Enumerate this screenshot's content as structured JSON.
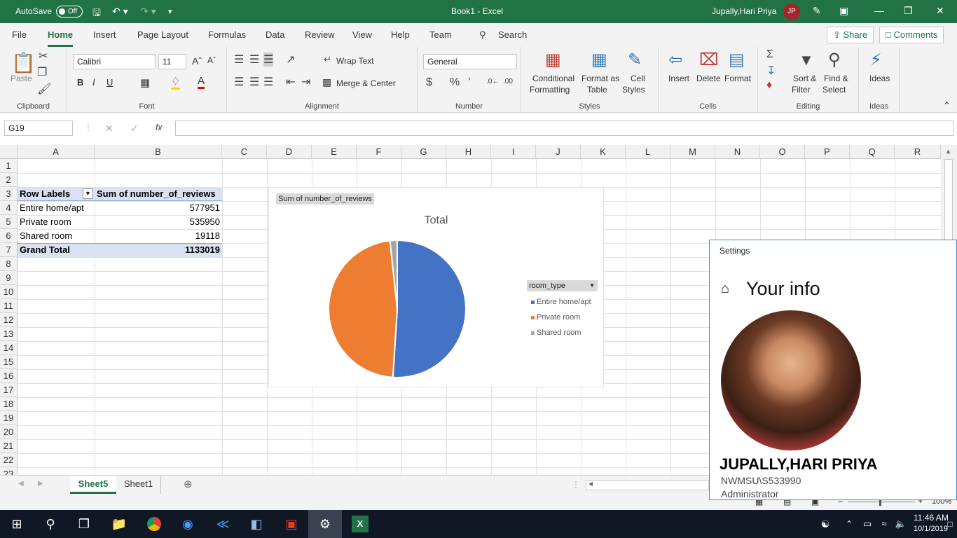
{
  "titlebar": {
    "autosave_label": "AutoSave",
    "autosave_state": "Off",
    "document_title": "Book1  -  Excel",
    "user_name": "Jupally,Hari Priya",
    "user_initials": "JP"
  },
  "menu": {
    "tabs": [
      "File",
      "Home",
      "Insert",
      "Page Layout",
      "Formulas",
      "Data",
      "Review",
      "View",
      "Help",
      "Team"
    ],
    "active_tab": "Home",
    "search_label": "Search",
    "share_label": "Share",
    "comments_label": "Comments"
  },
  "ribbon": {
    "clipboard": {
      "group": "Clipboard",
      "paste": "Paste"
    },
    "font": {
      "group": "Font",
      "font_name": "Calibri",
      "font_size": "11"
    },
    "alignment": {
      "group": "Alignment",
      "wrap_text": "Wrap Text",
      "merge_center": "Merge & Center"
    },
    "number": {
      "group": "Number",
      "format": "General"
    },
    "styles": {
      "group": "Styles",
      "conditional_1": "Conditional",
      "conditional_2": "Formatting",
      "format_as_1": "Format as",
      "format_as_2": "Table",
      "cell_styles_1": "Cell",
      "cell_styles_2": "Styles"
    },
    "cells": {
      "group": "Cells",
      "insert": "Insert",
      "delete": "Delete",
      "format": "Format"
    },
    "editing": {
      "group": "Editing",
      "sort_1": "Sort &",
      "sort_2": "Filter",
      "find_1": "Find &",
      "find_2": "Select"
    },
    "ideas": {
      "group": "Ideas",
      "ideas": "Ideas"
    }
  },
  "formula_bar": {
    "name_box": "G19",
    "fx": "fx",
    "formula": ""
  },
  "sheet": {
    "columns": [
      "A",
      "B",
      "C",
      "D",
      "E",
      "F",
      "G",
      "H",
      "I",
      "J",
      "K",
      "L",
      "M",
      "N",
      "O",
      "P",
      "Q",
      "R"
    ],
    "rows": [
      "1",
      "2",
      "3",
      "4",
      "5",
      "6",
      "7",
      "8",
      "9",
      "10",
      "11",
      "12",
      "13",
      "14",
      "15",
      "16",
      "17",
      "18",
      "19",
      "20",
      "21",
      "22",
      "23"
    ],
    "pivot": {
      "header_labels": "Row Labels",
      "header_values": "Sum of number_of_reviews",
      "rows": [
        {
          "label": "Entire home/apt",
          "value": "577951"
        },
        {
          "label": "Private room",
          "value": "535950"
        },
        {
          "label": "Shared room",
          "value": "19118"
        }
      ],
      "total_label": "Grand Total",
      "total_value": "1133019"
    }
  },
  "chart_data": {
    "type": "pie",
    "title": "Total",
    "field_button": "Sum of number_of_reviews",
    "legend_field": "room_type",
    "categories": [
      "Entire home/apt",
      "Private room",
      "Shared room"
    ],
    "values": [
      577951,
      535950,
      19118
    ],
    "colors": [
      "#4472c4",
      "#ed7d31",
      "#a5a5a5"
    ],
    "legend_position": "right"
  },
  "sheet_tabs": {
    "tabs": [
      "Sheet5",
      "Sheet1"
    ],
    "active": "Sheet5"
  },
  "statusbar": {
    "zoom": "100%"
  },
  "settings_panel": {
    "window_title": "Settings",
    "heading": "Your info",
    "name": "JUPALLY,HARI PRIYA",
    "account": "NWMSU\\S533990",
    "role": "Administrator"
  },
  "taskbar": {
    "time": "11:46 AM",
    "date": "10/1/2019"
  }
}
